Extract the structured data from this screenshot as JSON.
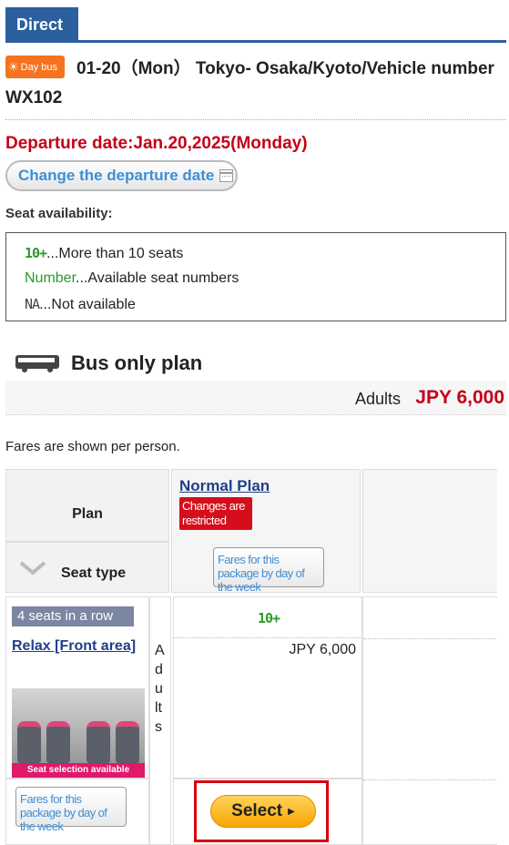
{
  "tabs": {
    "direct": "Direct"
  },
  "trip": {
    "badge": "Day bus",
    "badge_icon": "sun-icon",
    "title": "01-20（Mon） Tokyo- Osaka/Kyoto/Vehicle number WX102"
  },
  "departure": {
    "date_text": "Departure date:Jan.20,2025(Monday)",
    "change_button": "Change the departure date",
    "change_icon": "calendar-icon"
  },
  "seat_availability": {
    "label": "Seat availability:",
    "legend": [
      {
        "mark": "10+",
        "text": "...More than 10 seats"
      },
      {
        "mark": "Number",
        "text": "...Available seat numbers"
      },
      {
        "mark": "NA",
        "text": "...Not available"
      }
    ]
  },
  "plan": {
    "icon": "bus-icon",
    "title": "Bus only plan",
    "price_label": "Adults",
    "price_value": "JPY 6,000",
    "fares_note": "Fares are shown per person."
  },
  "table": {
    "plan_header": "Plan",
    "seat_type_header": "Seat type",
    "normal_plan": "Normal Plan",
    "restricted_badge": "Changes are restricted",
    "fares_package_button": "Fares for this package by day of the week",
    "seat_row": {
      "badge": "4 seats in a row",
      "name": "Relax [Front area]",
      "photo_caption": "Seat selection available",
      "passenger": "Adults",
      "availability": "10+",
      "fare": "JPY 6,000",
      "select_button": "Select"
    }
  },
  "colors": {
    "brand_blue": "#2b5f9e",
    "alert_red": "#c4001a",
    "availability_green": "#2a9a2a",
    "select_orange": "#f7a600"
  }
}
